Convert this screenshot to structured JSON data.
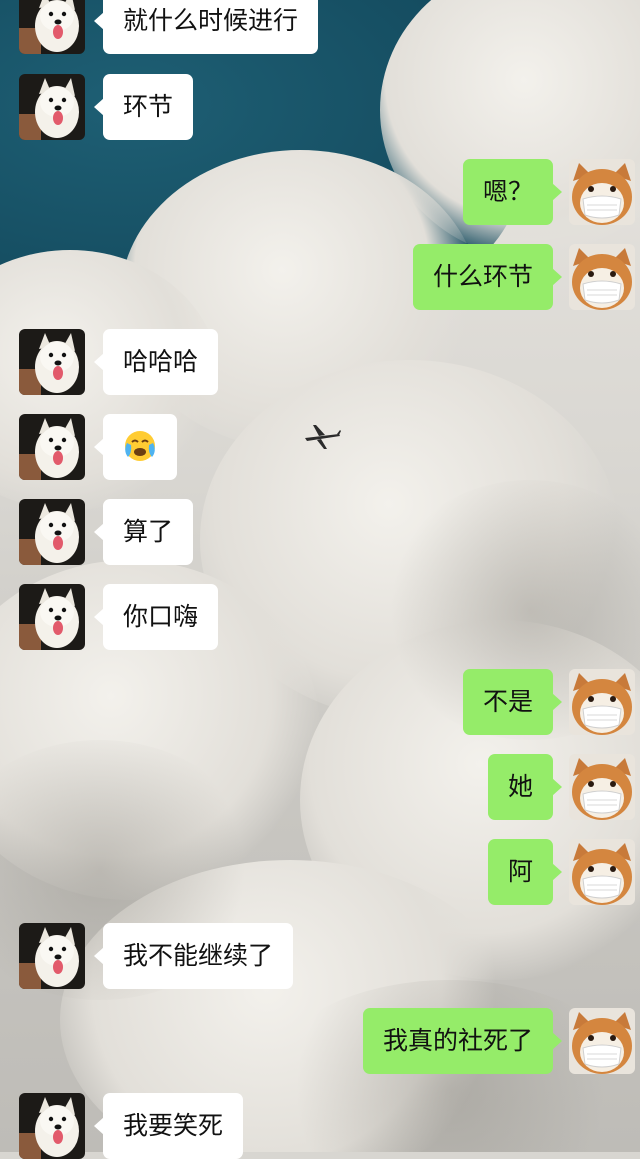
{
  "colors": {
    "incoming_bubble": "#ffffff",
    "outgoing_bubble": "#95ec69",
    "text": "#111111"
  },
  "contacts": {
    "incoming_avatar": "samoyed-dog-avatar",
    "outgoing_avatar": "shiba-inu-mask-avatar"
  },
  "messages": [
    {
      "side": "in",
      "type": "text",
      "text": "就什么时候进行"
    },
    {
      "side": "in",
      "type": "text",
      "text": "环节"
    },
    {
      "side": "out",
      "type": "text",
      "text": "嗯？"
    },
    {
      "side": "out",
      "type": "text",
      "text": "什么环节"
    },
    {
      "side": "in",
      "type": "text",
      "text": "哈哈哈"
    },
    {
      "side": "in",
      "type": "emoji",
      "text": "",
      "emoji": "loudly-crying-face-icon"
    },
    {
      "side": "in",
      "type": "text",
      "text": "算了"
    },
    {
      "side": "in",
      "type": "text",
      "text": "你口嗨"
    },
    {
      "side": "out",
      "type": "text",
      "text": "不是"
    },
    {
      "side": "out",
      "type": "text",
      "text": "她"
    },
    {
      "side": "out",
      "type": "text",
      "text": "阿"
    },
    {
      "side": "in",
      "type": "text",
      "text": "我不能继续了"
    },
    {
      "side": "out",
      "type": "text",
      "text": "我真的社死了"
    },
    {
      "side": "in",
      "type": "text",
      "text": "我要笑死"
    }
  ]
}
